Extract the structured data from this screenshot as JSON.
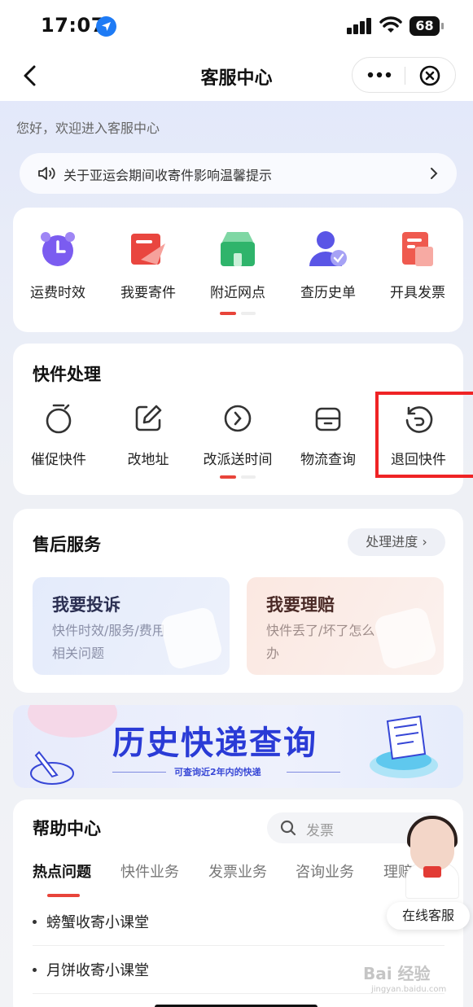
{
  "status": {
    "time": "17:07",
    "battery": "68"
  },
  "nav": {
    "title": "客服中心"
  },
  "greeting": "您好，欢迎进入客服中心",
  "notice": {
    "text": "关于亚运会期间收寄件影响温馨提示"
  },
  "quick_items": [
    {
      "label": "运费时效",
      "icon": "alarm-clock-icon",
      "color": "#7b5cf0"
    },
    {
      "label": "我要寄件",
      "icon": "send-package-icon",
      "color": "#e9463f"
    },
    {
      "label": "附近网点",
      "icon": "store-icon",
      "color": "#2fb46b"
    },
    {
      "label": "查历史单",
      "icon": "user-check-icon",
      "color": "#5a55e6"
    },
    {
      "label": "开具发票",
      "icon": "invoice-icon",
      "color": "#ef5a4f"
    }
  ],
  "express": {
    "title": "快件处理",
    "items": [
      {
        "label": "催促快件",
        "icon": "stopwatch-icon"
      },
      {
        "label": "改地址",
        "icon": "edit-icon"
      },
      {
        "label": "改派送时间",
        "icon": "clock-icon"
      },
      {
        "label": "物流查询",
        "icon": "box-icon"
      },
      {
        "label": "退回快件",
        "icon": "return-icon"
      }
    ]
  },
  "after_sales": {
    "title": "售后服务",
    "progress_label": "处理进度",
    "complaint": {
      "title": "我要投诉",
      "desc": "快件时效/服务/费用相关问题"
    },
    "claim": {
      "title": "我要理赔",
      "desc": "快件丢了/坏了怎么办"
    }
  },
  "banner": {
    "title": "历史快递查询",
    "subtitle": "可查询近2年内的快递"
  },
  "help": {
    "title": "帮助中心",
    "search_placeholder": "发票",
    "tabs": [
      "热点问题",
      "快件业务",
      "发票业务",
      "咨询业务",
      "理赔业务"
    ],
    "questions": [
      "螃蟹收寄小课堂",
      "月饼收寄小课堂"
    ]
  },
  "agent": {
    "label": "在线客服"
  },
  "watermark": {
    "main": "Bai 经验",
    "sub": "jingyan.baidu.com"
  }
}
